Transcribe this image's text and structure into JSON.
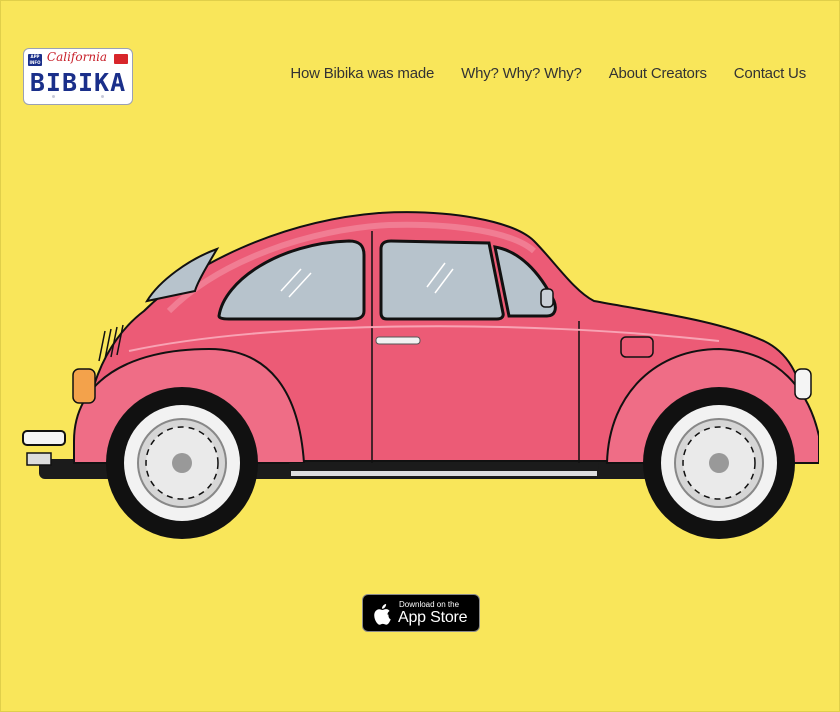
{
  "logo": {
    "badge": "APP INFO",
    "state": "California",
    "plate": "BIBIKA"
  },
  "nav": {
    "items": [
      {
        "label": "How Bibika was made"
      },
      {
        "label": "Why? Why? Why?"
      },
      {
        "label": "About Creators"
      },
      {
        "label": "Contact Us"
      }
    ]
  },
  "hero": {
    "image": "pink-beetle-car-illustration"
  },
  "app_store": {
    "small": "Download on the",
    "big": "App Store",
    "icon": "apple-icon"
  },
  "colors": {
    "background": "#f9e65a",
    "car_body": "#ec5b76",
    "plate_blue": "#1a2f8a"
  }
}
